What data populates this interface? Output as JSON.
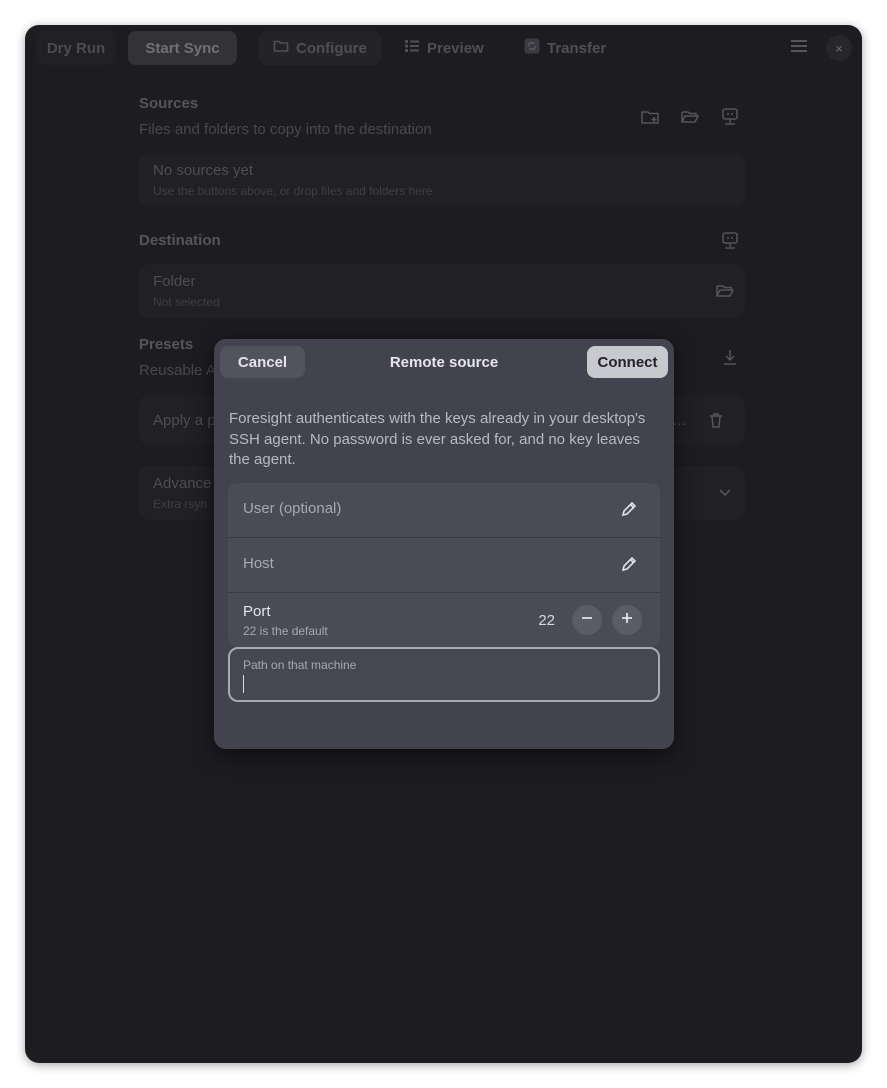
{
  "header": {
    "dry_run": "Dry Run",
    "start_sync": "Start Sync",
    "tabs": [
      {
        "label": "Configure",
        "icon": "folder-icon"
      },
      {
        "label": "Preview",
        "icon": "list-icon"
      },
      {
        "label": "Transfer",
        "icon": "sync-icon"
      }
    ],
    "close": "×"
  },
  "sources": {
    "title": "Sources",
    "subtitle": "Files and folders to copy into the destination",
    "empty_title": "No sources yet",
    "empty_sub": "Use the buttons above, or drop files and folders here"
  },
  "destination": {
    "title": "Destination",
    "folder_title": "Folder",
    "folder_sub": "Not selected"
  },
  "presets": {
    "title": "Presets",
    "subtitle": "Reusable A",
    "apply": "Apply a p",
    "apply_tail": "t..."
  },
  "advanced": {
    "title": "Advance",
    "subtitle": "Extra rsyn"
  },
  "dialog": {
    "cancel": "Cancel",
    "title": "Remote source",
    "connect": "Connect",
    "description": "Foresight authenticates with the keys already in your desktop's SSH agent. No password is ever asked for, and no key leaves the agent.",
    "user_label": "User (optional)",
    "host_label": "Host",
    "port_title": "Port",
    "port_sub": "22 is the default",
    "port_value": "22",
    "path_label": "Path on that machine",
    "path_value": ""
  },
  "colors": {
    "window_bg": "#1c1c21",
    "dialog_bg": "#43434f",
    "connect_bg": "#c8c8cf"
  }
}
